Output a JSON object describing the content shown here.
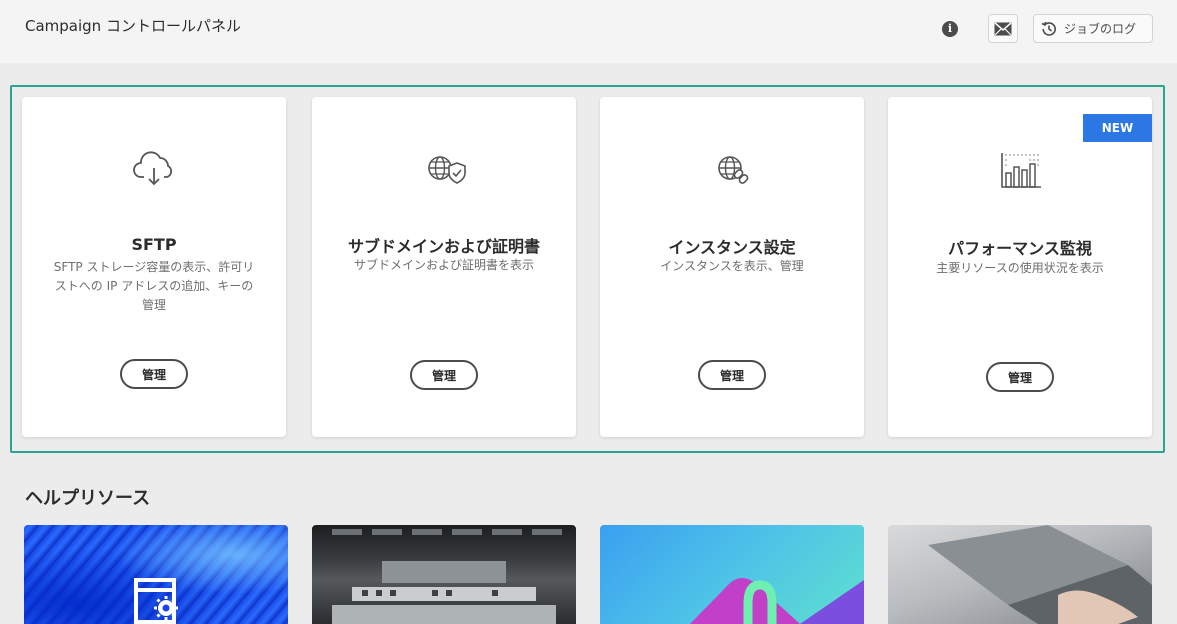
{
  "header": {
    "app_title": "Campaign コントロールパネル",
    "job_log_label": "ジョブのログ"
  },
  "cards": [
    {
      "icon": "cloud-download-icon",
      "title": "SFTP",
      "description": "SFTP ストレージ容量の表示、許可リストへの IP アドレスの追加、キーの管理",
      "button": "管理"
    },
    {
      "icon": "globe-shield-icon",
      "title": "サブドメインおよび証明書",
      "description": "サブドメインおよび証明書を表示",
      "button": "管理"
    },
    {
      "icon": "globe-link-icon",
      "title": "インスタンス設定",
      "description": "インスタンスを表示、管理",
      "button": "管理"
    },
    {
      "icon": "bar-chart-icon",
      "title": "パフォーマンス監視",
      "description": "主要リソースの使用状況を表示",
      "button": "管理",
      "badge": "NEW"
    }
  ],
  "help": {
    "title": "ヘルプリソース"
  },
  "colors": {
    "highlight": "#2aa58f",
    "badge": "#2b78e4"
  }
}
